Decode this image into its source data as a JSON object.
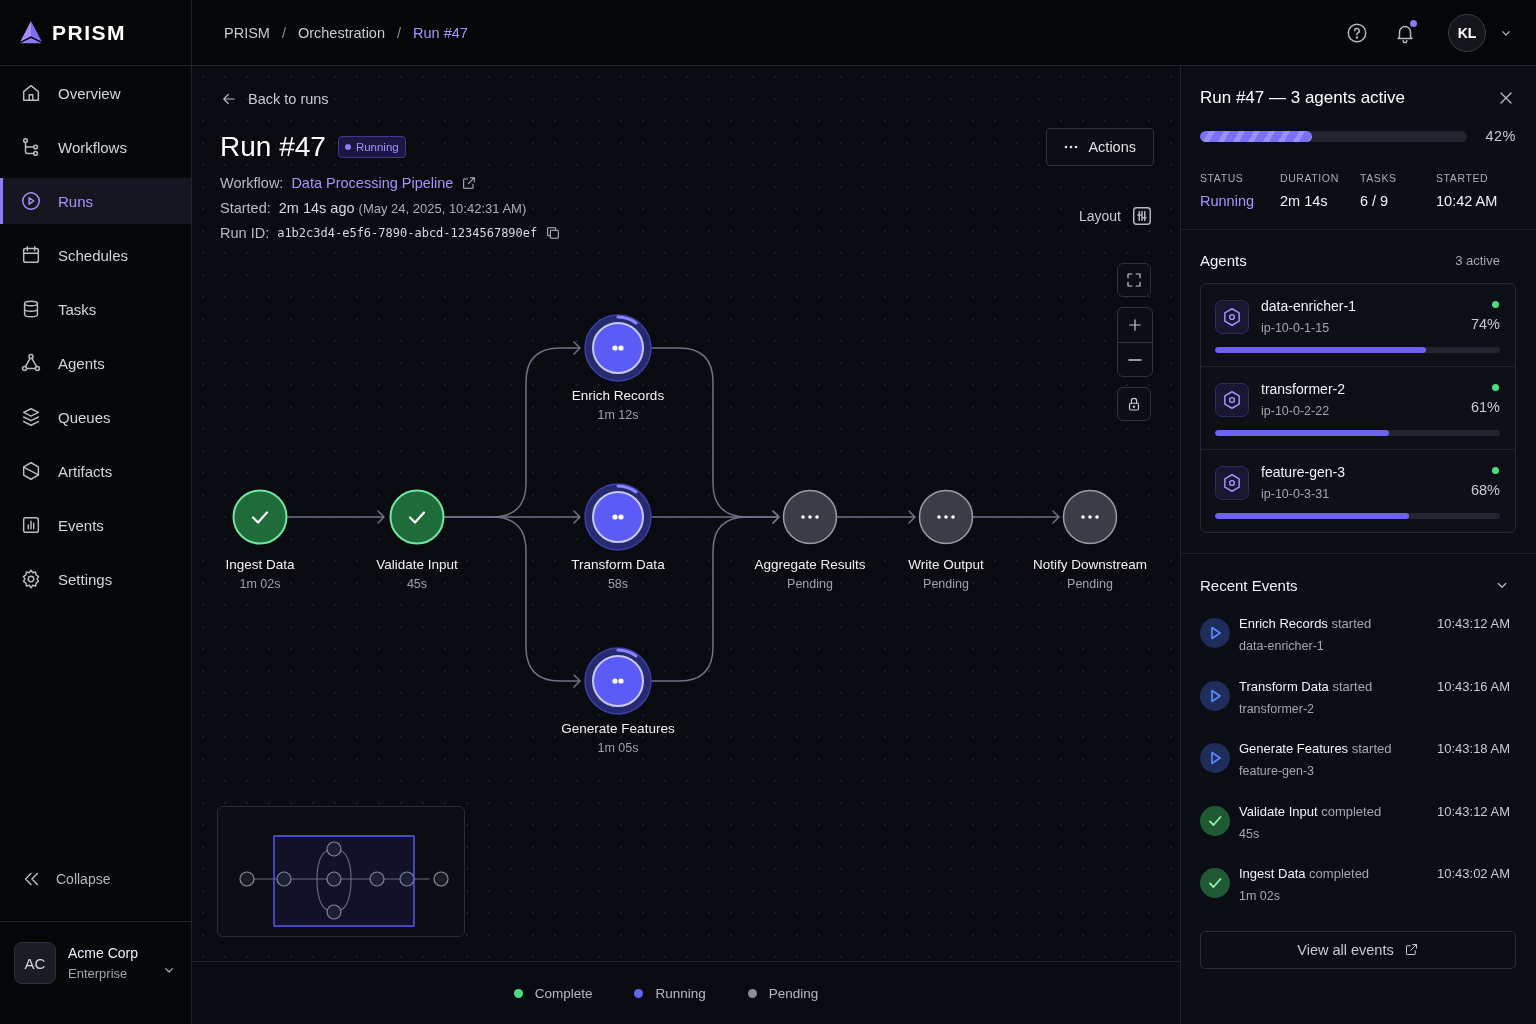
{
  "brand": {
    "name": "PRISM"
  },
  "breadcrumb": {
    "separator": "/",
    "items": [
      {
        "label": "PRISM",
        "current": false
      },
      {
        "label": "Orchestration",
        "current": false
      },
      {
        "label": "Run #47",
        "current": true
      }
    ]
  },
  "header": {
    "user_initials": "KL",
    "notifications_unread": true
  },
  "sidebar": {
    "items": [
      {
        "label": "Overview",
        "selected": false
      },
      {
        "label": "Workflows",
        "selected": false
      },
      {
        "label": "Runs",
        "selected": true
      },
      {
        "label": "Schedules",
        "selected": false
      },
      {
        "label": "Tasks",
        "selected": false
      },
      {
        "label": "Agents",
        "selected": false
      },
      {
        "label": "Queues",
        "selected": false
      },
      {
        "label": "Artifacts",
        "selected": false
      },
      {
        "label": "Events",
        "selected": false
      },
      {
        "label": "Settings",
        "selected": false
      }
    ],
    "collapse": "Collapse",
    "account": {
      "initials": "AC",
      "name": "Acme Corp",
      "plan": "Enterprise"
    }
  },
  "run": {
    "back": "Back to runs",
    "title": "Run #47",
    "status": "Running",
    "workflow_label": "Workflow:",
    "workflow": "Data Processing Pipeline",
    "started_label": "Started:",
    "started": "2m 14s ago",
    "started_exact": "(May 24, 2025, 10:42:31 AM)",
    "run_id_label": "Run ID:",
    "run_id": "a1b2c3d4-e5f6-7890-abcd-1234567890ef",
    "actions": "Actions"
  },
  "canvas": {
    "layout_label": "Layout",
    "nodes": [
      {
        "label": "Ingest Data",
        "detail": "1m 02s",
        "kind": "complete"
      },
      {
        "label": "Validate Input",
        "detail": "45s",
        "kind": "complete"
      },
      {
        "label": "Enrich Records",
        "detail": "1m 12s",
        "kind": "running"
      },
      {
        "label": "Transform Data",
        "detail": "58s",
        "kind": "running"
      },
      {
        "label": "Generate Features",
        "detail": "1m 05s",
        "kind": "running"
      },
      {
        "label": "Aggregate Results",
        "detail": "Pending",
        "kind": "pending"
      },
      {
        "label": "Write Output",
        "detail": "Pending",
        "kind": "pending"
      },
      {
        "label": "Notify Downstream",
        "detail": "Pending",
        "kind": "pending"
      }
    ]
  },
  "legend": [
    {
      "label": "Complete",
      "color": "#4ade80"
    },
    {
      "label": "Running",
      "color": "#6366f1"
    },
    {
      "label": "Pending",
      "color": "#8b8f9c"
    }
  ],
  "panel": {
    "title": "Run #47 — 3 agents active",
    "progress": {
      "level": 0.42,
      "reading": "42%"
    },
    "stats": [
      {
        "label": "STATUS",
        "value": "Running",
        "kind": "status"
      },
      {
        "label": "DURATION",
        "value": "2m 14s",
        "kind": "plain"
      },
      {
        "label": "TASKS",
        "value": "6 / 9",
        "kind": "plain"
      },
      {
        "label": "STARTED",
        "value": "10:42 AM",
        "kind": "plain"
      }
    ],
    "agents_title": "Agents",
    "agents_count": "3 active",
    "agents": [
      {
        "name": "data-enricher-1",
        "host": "ip-10-0-1-15",
        "online": true,
        "level": 0.74,
        "reading": "74%"
      },
      {
        "name": "transformer-2",
        "host": "ip-10-0-2-22",
        "online": true,
        "level": 0.61,
        "reading": "61%"
      },
      {
        "name": "feature-gen-3",
        "host": "ip-10-0-3-31",
        "online": true,
        "level": 0.68,
        "reading": "68%"
      }
    ],
    "events_title": "Recent Events",
    "events_expanded": true,
    "events": [
      {
        "kind": "started",
        "text": "**Enrich Records** started",
        "detail": "data-enricher-1",
        "time": "10:43:12 AM"
      },
      {
        "kind": "started",
        "text": "**Transform Data** started",
        "detail": "transformer-2",
        "time": "10:43:16 AM"
      },
      {
        "kind": "started",
        "text": "**Generate Features** started",
        "detail": "feature-gen-3",
        "time": "10:43:18 AM"
      },
      {
        "kind": "completed",
        "text": "**Validate Input** completed",
        "detail": "45s",
        "time": "10:43:12 AM"
      },
      {
        "kind": "completed",
        "text": "**Ingest Data** completed",
        "detail": "1m 02s",
        "time": "10:43:02 AM"
      }
    ],
    "view_all": "View all events"
  }
}
